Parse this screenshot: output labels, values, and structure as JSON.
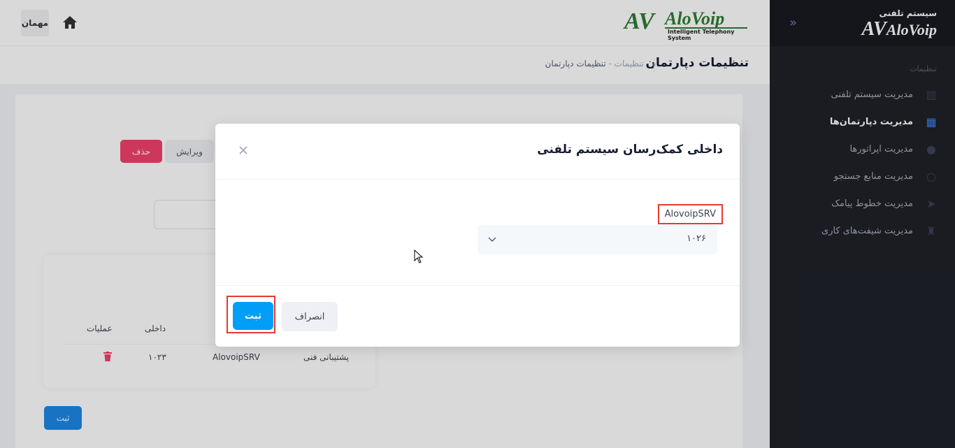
{
  "sidebar": {
    "logo_sub": "سیستم تلفنی",
    "logo_main": "AloVoip",
    "section_title": "تنظیمات",
    "items": [
      {
        "label": "مدیریت سیستم تلفنی",
        "icon": "phone-system-icon"
      },
      {
        "label": "مدیریت دپارتمان‌ها",
        "icon": "building-icon",
        "active": true
      },
      {
        "label": "مدیریت اپراتورها",
        "icon": "operator-icon"
      },
      {
        "label": "مدیریت منابع جستجو",
        "icon": "circle-icon"
      },
      {
        "label": "مدیریت خطوط پیامک",
        "icon": "send-icon"
      },
      {
        "label": "مدیریت شیفت‌های کاری",
        "icon": "shift-icon"
      }
    ]
  },
  "header": {
    "logo_name": "AloVoip",
    "logo_tagline": "Intelligent Telephony System",
    "user_label": "مهمان"
  },
  "page": {
    "title": "تنظیمات دپارتمان",
    "breadcrumb_parent": "تنظیمات",
    "breadcrumb_sep": "-",
    "breadcrumb_current": "تنظیمات دپارتمان"
  },
  "background": {
    "delete_label": "حذف",
    "edit_label": "ویرایش",
    "table_headers": [
      "عملیات",
      "داخلی"
    ],
    "row": {
      "department": "پشتیبانی فنی",
      "server": "AlovoipSRV",
      "extension": "۱۰۲۳"
    },
    "submit_label": "ثبت"
  },
  "modal": {
    "title": "داخلی کمک‌رسان سیستم تلفنی",
    "field_label": "AlovoipSRV",
    "selected_value": "۱۰۲۶",
    "cancel_label": "انصراف",
    "save_label": "ثبت"
  },
  "colors": {
    "sidebar_bg": "#1f2129",
    "primary": "#009ef7",
    "danger": "#f1416c",
    "highlight_box": "#e53935",
    "brand_green": "#2e7d32"
  }
}
